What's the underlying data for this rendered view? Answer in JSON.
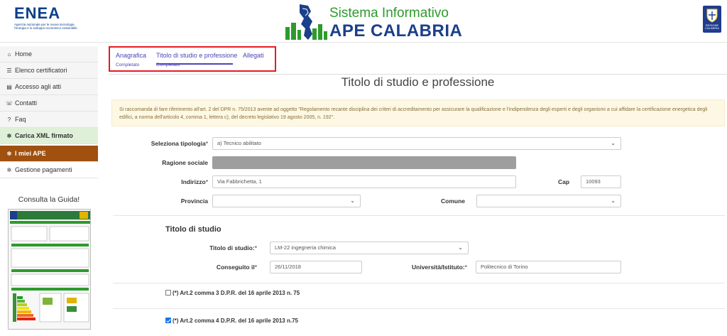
{
  "header": {
    "enea_word": "ENEA",
    "enea_tagline": "Agenzia nazionale per le nuove tecnologie, l'energia e lo sviluppo economico sostenibile",
    "title_line1": "Sistema Informativo",
    "title_line2": "APE CALABRIA",
    "region_text": "REGIONE CALABRIA"
  },
  "sidebar": {
    "items": [
      {
        "icon": "home-icon",
        "glyph": "⌂",
        "label": "Home"
      },
      {
        "icon": "list-icon",
        "glyph": "☰",
        "label": "Elenco certificatori"
      },
      {
        "icon": "document-icon",
        "glyph": "▤",
        "label": "Accesso agli atti"
      },
      {
        "icon": "phone-icon",
        "glyph": "☏",
        "label": "Contatti"
      },
      {
        "icon": "question-icon",
        "glyph": "?",
        "label": "Faq"
      },
      {
        "icon": "gear-icon",
        "glyph": "✲",
        "label": "Carica XML firmato"
      },
      {
        "icon": "gear-icon",
        "glyph": "✲",
        "label": "I miei APE"
      },
      {
        "icon": "gear-icon",
        "glyph": "✲",
        "label": "Gestione pagamenti"
      }
    ],
    "guide_title": "Consulta la Guida!"
  },
  "tabs": [
    {
      "label": "Anagrafica",
      "status": "Completato"
    },
    {
      "label": "Titolo di studio e professione",
      "status": "Completato"
    },
    {
      "label": "Allegati",
      "status": ""
    }
  ],
  "page_title": "Titolo di studio e professione",
  "alert_text": "Si raccomanda di fare riferimento all'art. 2 del DPR n. 75/2013 avente ad oggetto \"Regolamento recante disciplina dei criteri di accreditamento per assicurare la qualificazione e l'indipendenza degli esperti e degli organismi a cui affidare la certificazione energetica degli edifici, a norma dell'articolo 4, comma 1, lettera c), del decreto legislativo 19 agosto 2005, n. 192\".",
  "form": {
    "tipologia_label": "Seleziona tipologia",
    "tipologia_value": "a) Tecnico abilitato",
    "ragione_label": "Ragione sociale",
    "indirizzo_label": "Indirizzo",
    "indirizzo_value": "Via Fabbrichetta, 1",
    "cap_label": "Cap",
    "cap_value": "10093",
    "provincia_label": "Provincia",
    "comune_label": "Comune",
    "section_title": "Titolo di studio",
    "titolo_label": "Titolo di studio:",
    "titolo_value": "LM-22 ingegneria chimica",
    "conseguito_label": "Conseguito il",
    "conseguito_value": "26/11/2018",
    "universita_label": "Università/Istituto:",
    "universita_value": "Politecnico di Torino",
    "check1_label": "(*) Art.2 comma 3 D.P.R. del 16 aprile 2013 n. 75",
    "check2_label": "(*) Art.2 comma 4 D.P.R. del 16 aprile 2013 n.75",
    "required_mark": "*",
    "caret": "⌄"
  },
  "colors": {
    "active_sidebar": "#a0510f",
    "green_sidebar": "#dff0d8",
    "tab_text": "#4a46b8",
    "highlight_box": "#e31c23",
    "brand_green": "#2c9b2c",
    "brand_blue": "#1b3f8a"
  }
}
